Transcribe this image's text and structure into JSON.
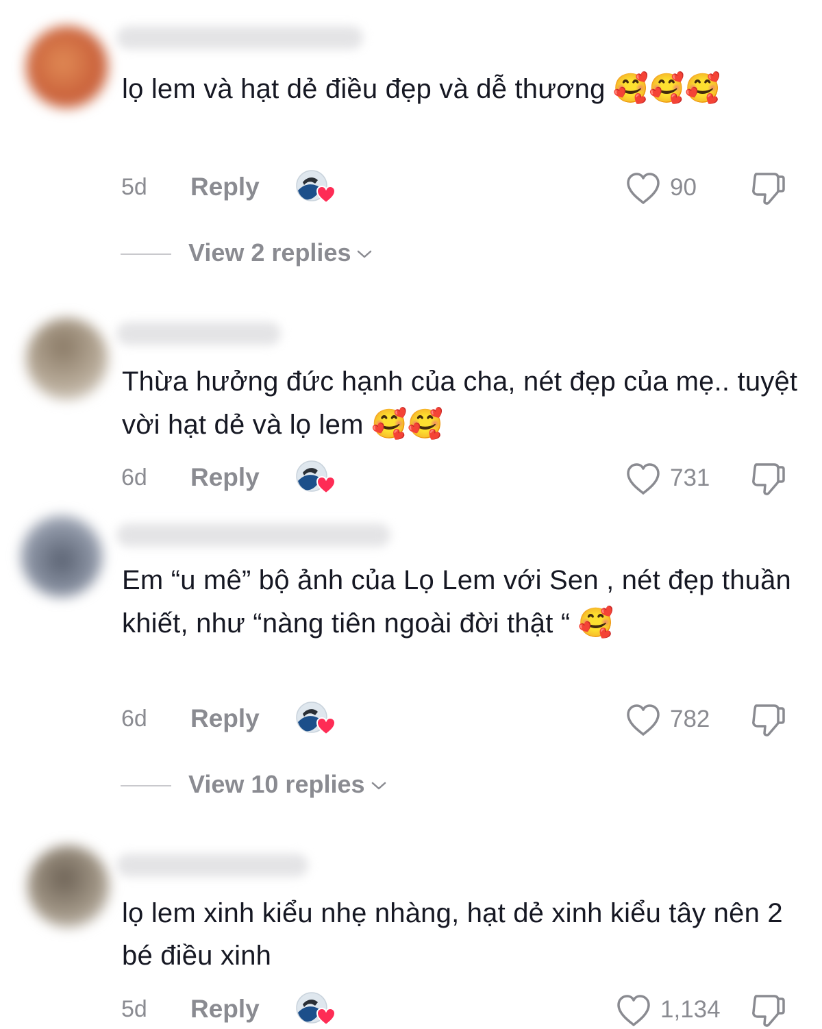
{
  "comments": [
    {
      "text": "lọ lem và hạt dẻ điều đẹp và dễ thương",
      "emojis": "🥰🥰🥰",
      "age": "5d",
      "reply_label": "Reply",
      "likes": "90",
      "view_replies": "View 2 replies"
    },
    {
      "text": "Thừa hưởng đức hạnh của cha, nét đẹp của mẹ.. tuyệt vời hạt dẻ và lọ lem",
      "emojis": "🥰🥰",
      "age": "6d",
      "reply_label": "Reply",
      "likes": "731"
    },
    {
      "text": "Em “u mê” bộ ảnh của Lọ Lem với Sen , nét đẹp thuần khiết, như “nàng tiên ngoài đời thật “",
      "emojis": "🥰",
      "age": "6d",
      "reply_label": "Reply",
      "likes": "782",
      "view_replies": "View 10 replies"
    },
    {
      "text": "lọ lem xinh kiểu nhẹ nhàng, hạt dẻ xinh kiểu tây nên 2 bé điều xinh",
      "emojis": "",
      "age": "5d",
      "reply_label": "Reply",
      "likes": "1,134"
    }
  ],
  "icons": {
    "like": "heart-outline-icon",
    "dislike": "thumbs-down-icon",
    "creator_badge": "creator-liked-icon",
    "expand": "chevron-down-icon"
  },
  "colors": {
    "text": "#161823",
    "muted": "#8a8b91",
    "heart_badge": "#fe2c55"
  }
}
